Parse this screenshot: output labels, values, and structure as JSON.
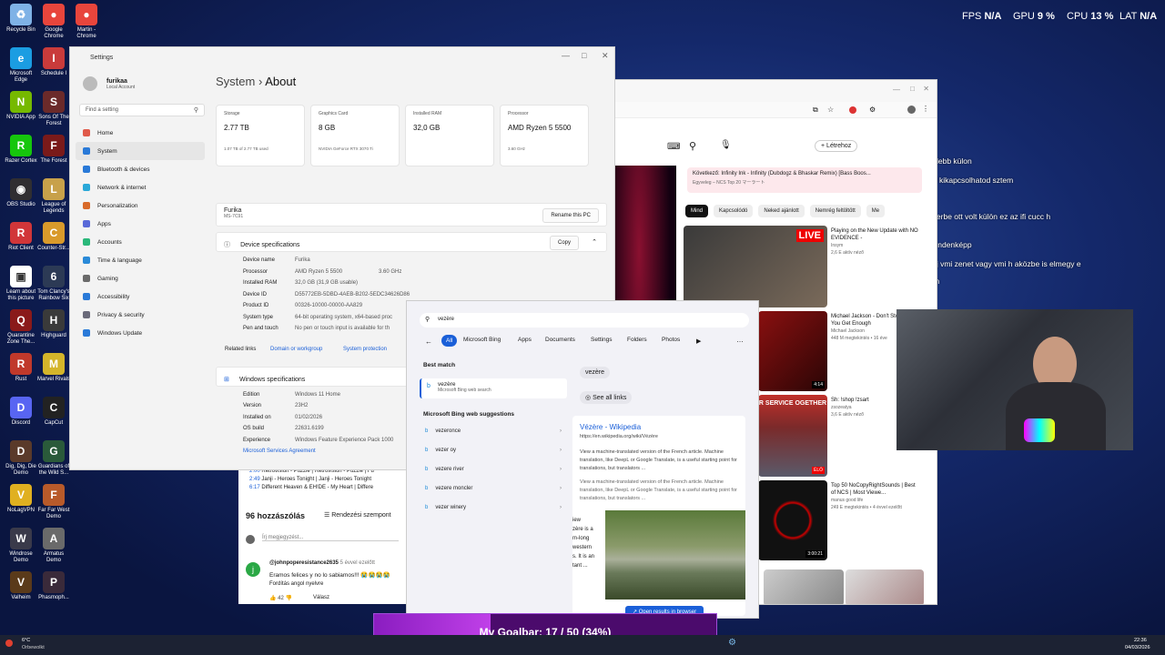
{
  "desktop_icons": [
    {
      "label": "Recycle Bin",
      "color": "#7fb2e6",
      "glyph": "♻"
    },
    {
      "label": "Google Chrome",
      "color": "#e8453c",
      "glyph": "●"
    },
    {
      "label": "Martin - Chrome",
      "color": "#e8453c",
      "glyph": "●"
    },
    {
      "label": "Microsoft Edge",
      "color": "#1b9de2",
      "glyph": "e"
    },
    {
      "label": "Schedule I",
      "color": "#c93b3b",
      "glyph": "I"
    },
    {
      "label": "NVIDIA App",
      "color": "#76b900",
      "glyph": "N"
    },
    {
      "label": "Sons Of The Forest",
      "color": "#6b2a2a",
      "glyph": "S"
    },
    {
      "label": "Razer Cortex",
      "color": "#16c60c",
      "glyph": "R"
    },
    {
      "label": "The Forest",
      "color": "#7a1a1a",
      "glyph": "F"
    },
    {
      "label": "OBS Studio",
      "color": "#302e31",
      "glyph": "◉"
    },
    {
      "label": "League of Legends",
      "color": "#c8a14a",
      "glyph": "L"
    },
    {
      "label": "Riot Client",
      "color": "#d13639",
      "glyph": "R"
    },
    {
      "label": "Counter-Str...",
      "color": "#d99a2b",
      "glyph": "C"
    },
    {
      "label": "Learn about this picture",
      "color": "#ffffff",
      "glyph": "▣"
    },
    {
      "label": "Tom Clancy's Rainbow Six",
      "color": "#2c3a55",
      "glyph": "6"
    },
    {
      "label": "Quarantine Zone The...",
      "color": "#8a1a1a",
      "glyph": "Q"
    },
    {
      "label": "Highguard",
      "color": "#3a3a3a",
      "glyph": "H"
    },
    {
      "label": "Rust",
      "color": "#c0392b",
      "glyph": "R"
    },
    {
      "label": "Marvel Rivals",
      "color": "#d4b52a",
      "glyph": "M"
    },
    {
      "label": "Discord",
      "color": "#5865f2",
      "glyph": "D"
    },
    {
      "label": "CapCut",
      "color": "#222222",
      "glyph": "C"
    },
    {
      "label": "Dig, Dig, Die Demo",
      "color": "#5a3a2a",
      "glyph": "D"
    },
    {
      "label": "Guardians of the Wild S...",
      "color": "#2a5a3a",
      "glyph": "G"
    },
    {
      "label": "NoLagVPN",
      "color": "#e0b020",
      "glyph": "V"
    },
    {
      "label": "Far Far West Demo",
      "color": "#b85a2a",
      "glyph": "F"
    },
    {
      "label": "Windrose Demo",
      "color": "#3a3a4a",
      "glyph": "W"
    },
    {
      "label": "Armatus Demo",
      "color": "#6a6a6a",
      "glyph": "A"
    },
    {
      "label": "Valheim",
      "color": "#5a3a1a",
      "glyph": "V"
    },
    {
      "label": "Phasmoph...",
      "color": "#3a2a3a",
      "glyph": "P"
    }
  ],
  "hud": {
    "fps_label": "FPS",
    "fps": "N/A",
    "gpu_label": "GPU",
    "gpu": "9 %",
    "cpu_label": "CPU",
    "cpu": "13 %",
    "lat_label": "LAT",
    "lat": "N/A"
  },
  "settings": {
    "title": "Settings",
    "user_name": "furikaa",
    "user_type": "Local Account",
    "search_placeholder": "Find a setting",
    "nav": [
      {
        "label": "Home",
        "color": "#e05a4a"
      },
      {
        "label": "System",
        "color": "#2a7ad8"
      },
      {
        "label": "Bluetooth & devices",
        "color": "#2a7ad8"
      },
      {
        "label": "Network & internet",
        "color": "#2aa8d8"
      },
      {
        "label": "Personalization",
        "color": "#d86a2a"
      },
      {
        "label": "Apps",
        "color": "#5a6ad8"
      },
      {
        "label": "Accounts",
        "color": "#2ab87a"
      },
      {
        "label": "Time & language",
        "color": "#2a8ad8"
      },
      {
        "label": "Gaming",
        "color": "#6a6a6a"
      },
      {
        "label": "Accessibility",
        "color": "#2a7ad8"
      },
      {
        "label": "Privacy & security",
        "color": "#6a6a7a"
      },
      {
        "label": "Windows Update",
        "color": "#2a7ad8"
      }
    ],
    "breadcrumb_parent": "System",
    "breadcrumb_sep": "›",
    "breadcrumb_current": "About",
    "cards": [
      {
        "label": "Storage",
        "value": "2.77 TB",
        "sub": "1.07 TB of 2.77 TB used"
      },
      {
        "label": "Graphics Card",
        "value": "8 GB",
        "sub": "NVIDIA GeForce RTX 3070 Ti"
      },
      {
        "label": "Installed RAM",
        "value": "32,0 GB",
        "sub": ""
      },
      {
        "label": "Processor",
        "value": "AMD Ryzen 5 5500",
        "sub": "3.60 GHz"
      }
    ],
    "device_name": "Furika",
    "device_model": "MS-7C91",
    "rename_label": "Rename this PC",
    "device_specs_title": "Device specifications",
    "copy_label": "Copy",
    "specs": [
      {
        "k": "Device name",
        "v": "Furika",
        "v2": ""
      },
      {
        "k": "Processor",
        "v": "AMD Ryzen 5 5500",
        "v2": "3.60 GHz"
      },
      {
        "k": "Installed RAM",
        "v": "32,0 GB (31,9 GB usable)",
        "v2": ""
      },
      {
        "k": "Device ID",
        "v": "D55772EB-5DBD-4AEB-B202-5EDC34626D86",
        "v2": ""
      },
      {
        "k": "Product ID",
        "v": "00326-10000-00000-AA829",
        "v2": ""
      },
      {
        "k": "System type",
        "v": "64-bit operating system, x64-based proc",
        "v2": ""
      },
      {
        "k": "Pen and touch",
        "v": "No pen or touch input is available for th",
        "v2": ""
      }
    ],
    "related_links_label": "Related links",
    "related_links": [
      "Domain or workgroup",
      "System protection"
    ],
    "win_specs_title": "Windows specifications",
    "win_specs": [
      {
        "k": "Edition",
        "v": "Windows 11 Home"
      },
      {
        "k": "Version",
        "v": "23H2"
      },
      {
        "k": "Installed on",
        "v": "01/02/2026"
      },
      {
        "k": "OS build",
        "v": "22631.6199"
      },
      {
        "k": "Experience",
        "v": "Windows Feature Experience Pack 1000"
      }
    ],
    "msa_link": "Microsoft Services Agreement"
  },
  "browser": {
    "create_label": "Létrehoz",
    "next_label": "Következő: Infinity Ink - Infinity (Dubdogz & Bhaskar Remix) [Bass Boos...",
    "next_sub": "Egyveleg – NCS Top 20 マーラート",
    "chips": [
      "Mind",
      "Kapcsolódó",
      "Neked ajánlott",
      "Nemrég feltöltött",
      "Me"
    ],
    "videos": [
      {
        "title": "Playing on the New Update with NO EVIDENCE -",
        "meta": "Insym",
        "meta2": "2,6 E aktív néző",
        "badge": "LIVE"
      },
      {
        "title": "Michael Jackson - Don't Stop 'Til You Get Enough",
        "meta": "Michael Jackson",
        "meta2": "448 M megtekintés • 16 éve",
        "badge": "4:14"
      },
      {
        "title": "Sh: !shop !zsart",
        "meta": "zsozeatya",
        "meta2": "3,6 E aktív néző",
        "badge": "ÉLŐ"
      },
      {
        "title": "Top 50 NoCopyRightSounds | Best of NCS | Most Viewe...",
        "meta": "manus good life",
        "meta2": "249 E megtekintés • 4 évvel ezelőtt",
        "badge": "3:00:21"
      }
    ],
    "thumb_text": "R SERVICE OGETHER"
  },
  "search_panel": {
    "query": "vezère",
    "filters": [
      "All",
      "Microsoft Bing",
      "Apps",
      "Documents",
      "Settings",
      "Folders",
      "Photos"
    ],
    "more_glyph": "…",
    "best_match_label": "Best match",
    "best_match_title": "vezère",
    "best_match_sub": "Microsoft Bing web search",
    "bing_label": "Microsoft Bing web suggestions",
    "suggestions": [
      "vezeronce",
      "vezer oy",
      "vezere river",
      "vezere moncler",
      "vezer winery"
    ],
    "pill": "vezère",
    "see_all": "See all links",
    "wiki_title": "Vézère - Wikipedia",
    "wiki_url": "https://en.wikipedia.org/wiki/Vézère",
    "wiki_desc": "View a machine-translated version of the French article. Machine translation, like DeepL or Google Translate, is a useful starting point for translations, but translators ...",
    "wiki_desc2": "View a machine-translated version of the French article. Machine translation, like DeepL or Google Translate, is a useful starting point for translations, but translators ...",
    "side_snip": [
      "iew",
      "zère is a",
      "m-long",
      "western",
      "s. It is an",
      "tant ..."
    ],
    "open_results": "Open results in browser"
  },
  "yt_comments": {
    "playlist": [
      {
        "time": "2:00",
        "text": "Retrovision - Puzzle | Retrovision - Puzzle | Fu"
      },
      {
        "time": "2:49",
        "text": "Janji - Heroes Tonight | Janji - Heroes Tonight"
      },
      {
        "time": "6:17",
        "text": "Different Heaven & EH!DE - My Heart | Differe"
      }
    ],
    "count": "96 hozzászólás",
    "sort": "Rendezési szempont",
    "placeholder": "Írj megjegyzést...",
    "author": "@johnpoperesistance2635",
    "age": "5 évvel ezelőtt",
    "comment": "Eramos felices y no lo sabiamos!!! 😭😭😭😭",
    "translate": "Fordítás angol nyelvre",
    "likes": "42",
    "reply": "Válasz"
  },
  "chat": [
    "fejlebb külon",
    "snél kikapcsolhatod sztem",
    "ent",
    "meg a device managerbe ott volt külön ez az ifi cucc h",
    "dugd mindenképp",
    "kapcsolj vmi zenet vagy vmi h aközbe is elmegy e",
    "kozott ha jól hallottam"
  ],
  "goal": {
    "text": "My Goalbar: 17 / 50 (34%)",
    "fraction": 0.34
  },
  "taskbar": {
    "weather_temp": "6°C",
    "weather_desc": "Orbewolkt",
    "time": "22:36",
    "date": "04/03/2026"
  }
}
